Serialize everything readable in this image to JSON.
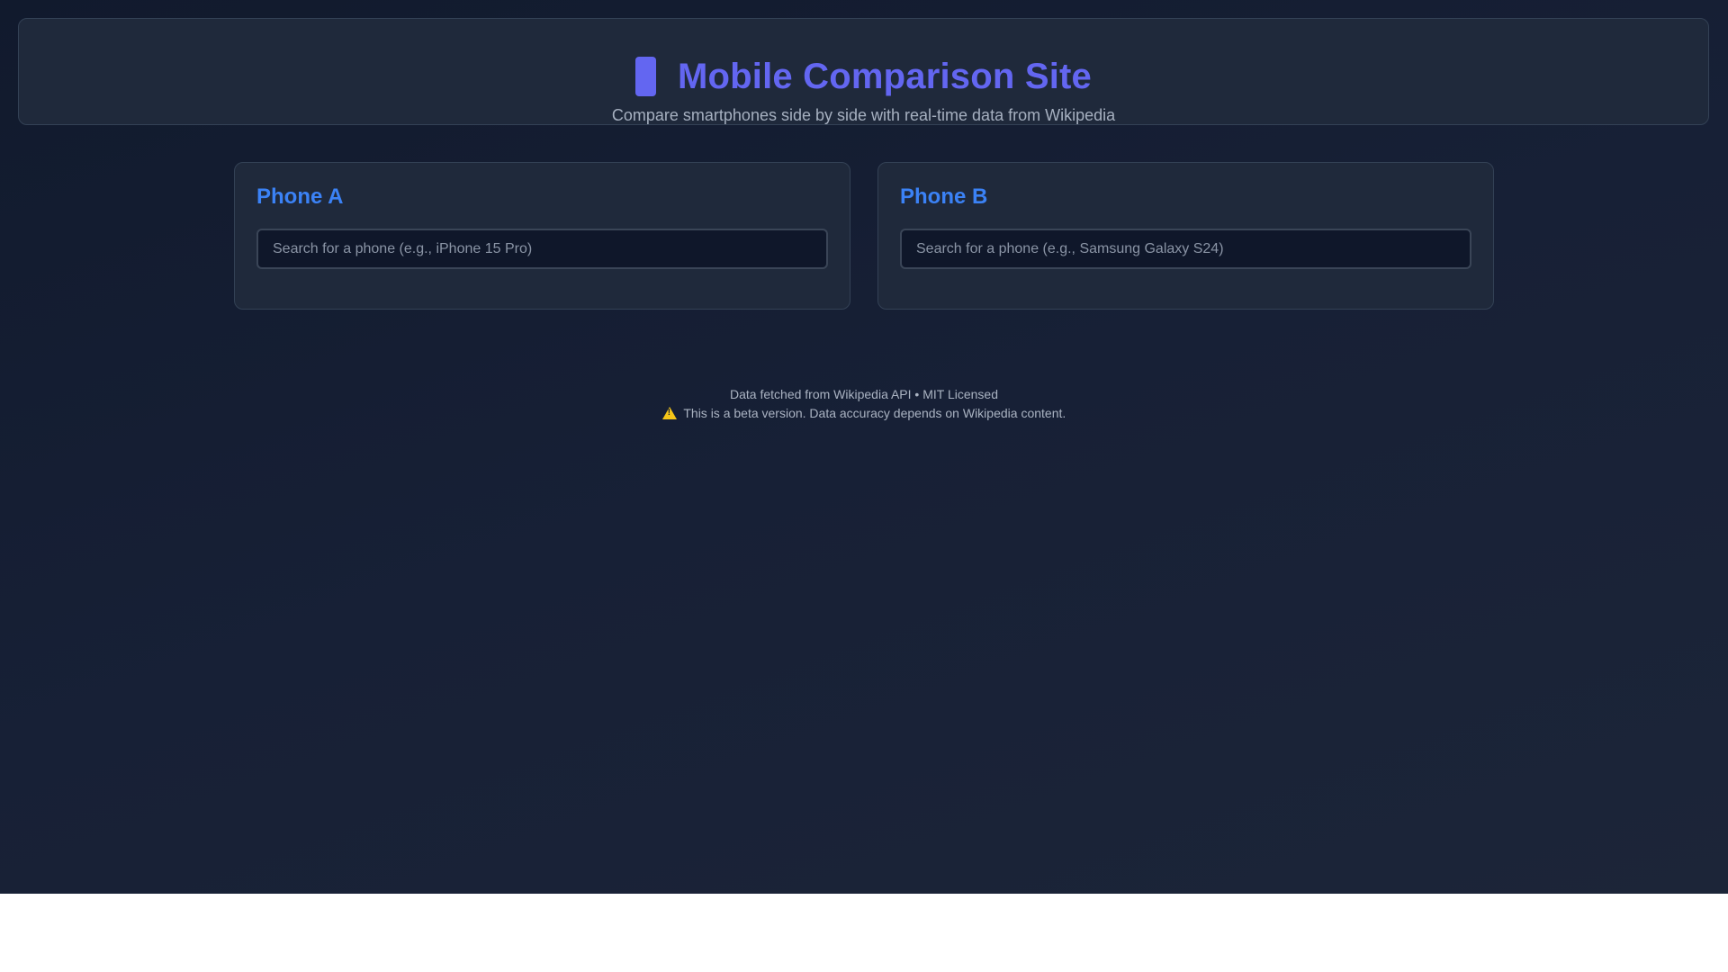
{
  "header": {
    "icon": "mobile-phone-icon",
    "title": "Mobile Comparison Site",
    "subtitle": "Compare smartphones side by side with real-time data from Wikipedia"
  },
  "panels": [
    {
      "title": "Phone A",
      "search": {
        "value": "",
        "placeholder": "Search for a phone (e.g., iPhone 15 Pro)"
      }
    },
    {
      "title": "Phone B",
      "search": {
        "value": "",
        "placeholder": "Search for a phone (e.g., Samsung Galaxy S24)"
      }
    }
  ],
  "footer": {
    "line1": "Data fetched from Wikipedia API • MIT Licensed",
    "warning_icon": "warning-icon",
    "line2": "This is a beta version. Data accuracy depends on Wikipedia content."
  },
  "colors": {
    "accent": "#6366f1",
    "panel_title": "#3b82f6",
    "background": "#111a2d",
    "card": "#1f293b",
    "warning": "#f5c518"
  }
}
